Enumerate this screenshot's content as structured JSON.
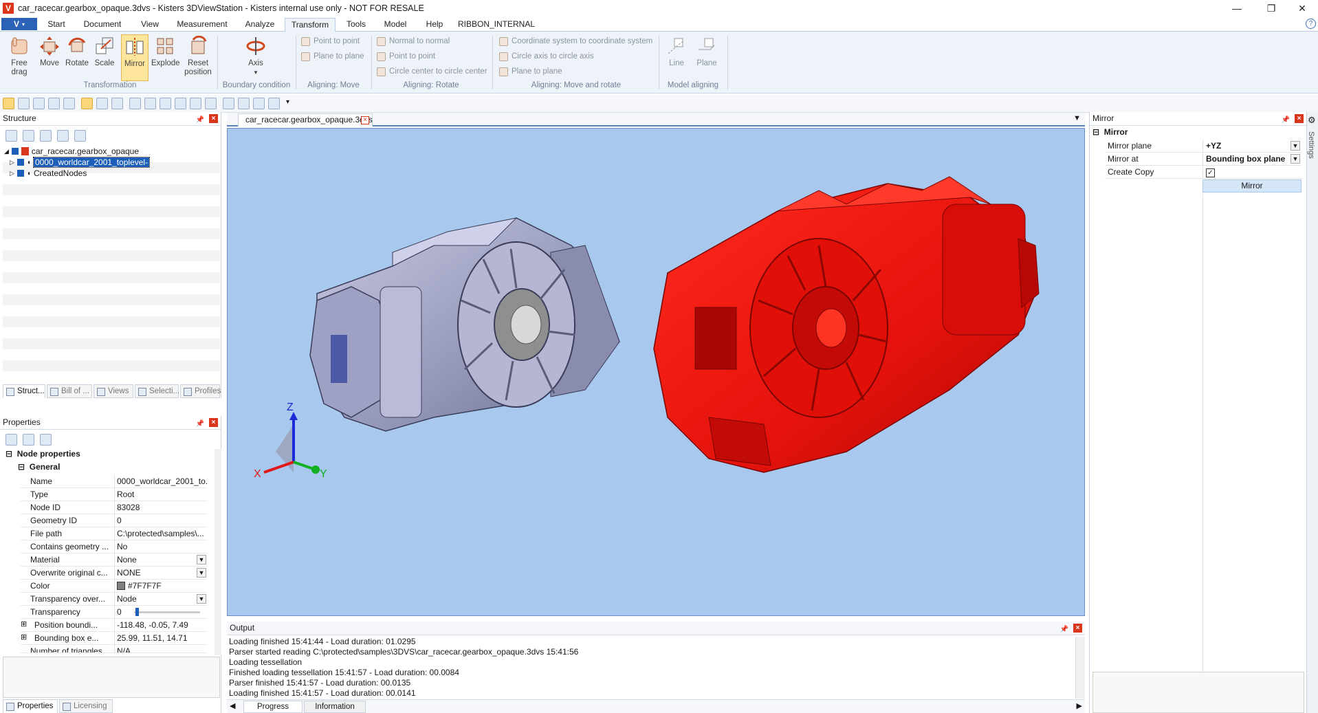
{
  "window": {
    "title": "car_racecar.gearbox_opaque.3dvs - Kisters 3DViewStation - Kisters internal use only - NOT FOR RESALE",
    "logo_letter": "V",
    "minimize_glyph": "—",
    "maximize_glyph": "❐",
    "close_glyph": "✕"
  },
  "menu": {
    "app_button": "V",
    "tabs": [
      "Start",
      "Document",
      "View",
      "Measurement",
      "Analyze",
      "Transform",
      "Tools",
      "Model",
      "Help",
      "RIBBON_INTERNAL"
    ],
    "active_tab": "Transform",
    "help_icon": "?"
  },
  "ribbon": {
    "transformation": {
      "label": "Transformation",
      "buttons": [
        {
          "label": "Free\ndrag",
          "icon": "hand-drag-icon"
        },
        {
          "label": "Move",
          "icon": "move-icon"
        },
        {
          "label": "Rotate",
          "icon": "rotate-icon"
        },
        {
          "label": "Scale",
          "icon": "scale-icon"
        },
        {
          "label": "Mirror",
          "icon": "mirror-icon",
          "active": true
        },
        {
          "label": "Explode",
          "icon": "explode-icon"
        },
        {
          "label": "Reset\nposition",
          "icon": "reset-position-icon"
        }
      ]
    },
    "boundary": {
      "label": "Boundary condition",
      "button": "Axis"
    },
    "aligning_move": {
      "label": "Aligning: Move",
      "items": [
        "Point to point",
        "Plane to plane"
      ]
    },
    "aligning_rotate": {
      "label": "Aligning: Rotate",
      "items": [
        "Normal to normal",
        "Point to point",
        "Circle center to circle center"
      ]
    },
    "aligning_move_rotate": {
      "label": "Aligning: Move and rotate",
      "items": [
        "Coordinate system to coordinate system",
        "Circle axis to circle axis",
        "Plane to plane"
      ]
    },
    "model_aligning": {
      "label": "Model aligning",
      "buttons": [
        "Line",
        "Plane"
      ]
    }
  },
  "structure": {
    "title": "Structure",
    "root": "car_racecar.gearbox_opaque",
    "children": [
      "0000_worldcar_2001_toplevel-",
      "CreatedNodes"
    ],
    "tabs": [
      "Struct...",
      "Bill of ...",
      "Views",
      "Selecti...",
      "Profiles"
    ]
  },
  "properties": {
    "title": "Properties",
    "section": "Node properties",
    "group": "General",
    "rows": [
      {
        "k": "Name",
        "v": "0000_worldcar_2001_to..."
      },
      {
        "k": "Type",
        "v": "Root"
      },
      {
        "k": "Node ID",
        "v": "83028"
      },
      {
        "k": "Geometry ID",
        "v": "0"
      },
      {
        "k": "File path",
        "v": "C:\\protected\\samples\\..."
      },
      {
        "k": "Contains geometry ...",
        "v": "No"
      },
      {
        "k": "Material",
        "v": "None"
      },
      {
        "k": "Overwrite original c...",
        "v": "NONE"
      },
      {
        "k": "Color",
        "v": "#7F7F7F"
      },
      {
        "k": "Transparency over...",
        "v": "Node"
      },
      {
        "k": "Transparency",
        "v": "0"
      },
      {
        "k": "Position boundi...",
        "v": "-118.48, -0.05, 7.49"
      },
      {
        "k": "Bounding box e...",
        "v": "25.99, 11.51, 14.71"
      },
      {
        "k": "Number of triangles",
        "v": "N/A"
      }
    ],
    "tabs": [
      "Properties",
      "Licensing"
    ]
  },
  "document": {
    "tab": "car_racecar.gearbox_opaque.3dvs",
    "axes": {
      "x": "X",
      "y": "Y",
      "z": "Z"
    },
    "colors": {
      "background": "#a8c8ee",
      "part_gray": "#9a9cbc",
      "part_red": "#e5120c"
    }
  },
  "mirror": {
    "title": "Mirror",
    "section": "Mirror",
    "rows": [
      {
        "k": "Mirror plane",
        "v": "+YZ"
      },
      {
        "k": "Mirror at",
        "v": "Bounding box plane"
      },
      {
        "k": "Create Copy",
        "v": "✓"
      }
    ],
    "button": "Mirror",
    "settings_tab": "Settings"
  },
  "output": {
    "title": "Output",
    "lines": [
      "Loading finished 15:41:44 - Load duration: 01.0295",
      "Parser started reading C:\\protected\\samples\\3DVS\\car_racecar.gearbox_opaque.3dvs 15:41:56",
      "Loading tessellation",
      "Finished loading tessellation 15:41:57 - Load duration: 00.0084",
      "Parser finished 15:41:57 - Load duration: 00.0135",
      "Loading finished 15:41:57 - Load duration: 00.0141"
    ],
    "tabs": [
      "Progress",
      "Information"
    ]
  }
}
